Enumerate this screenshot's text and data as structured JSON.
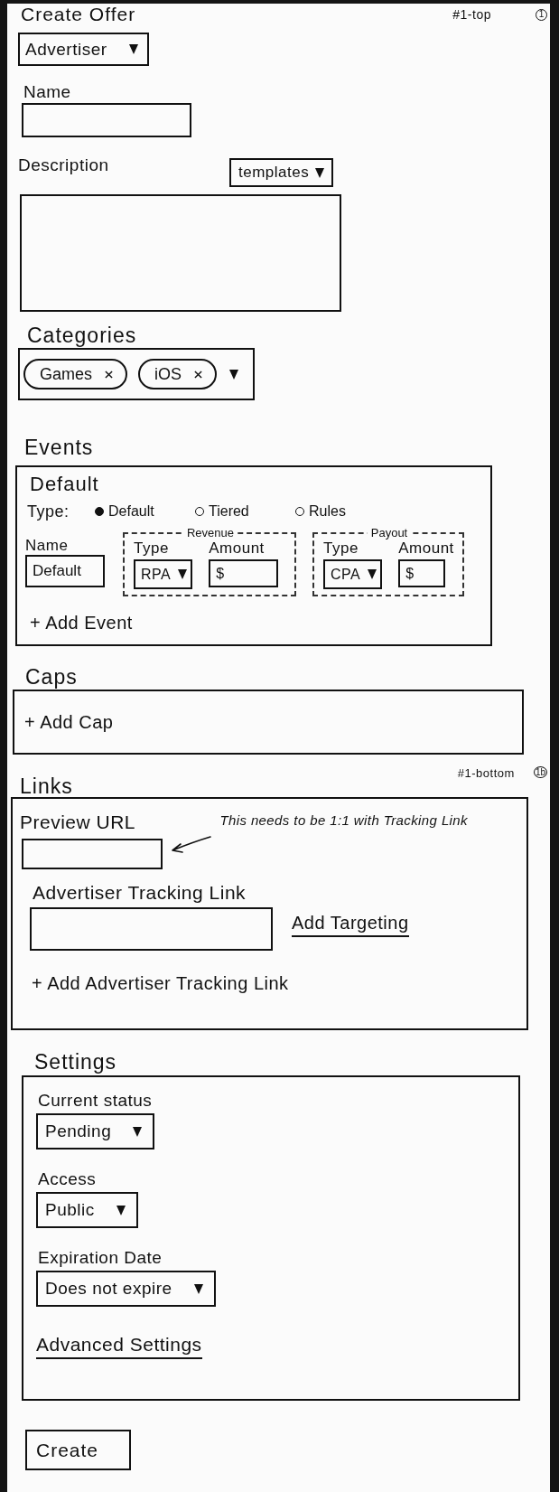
{
  "header": {
    "title": "Create Offer",
    "sheet_label": "#1-top",
    "sheet_number": "1",
    "advertiser_select": "Advertiser"
  },
  "name": {
    "label": "Name"
  },
  "description": {
    "label": "Description",
    "templates_select": "templates"
  },
  "categories": {
    "heading": "Categories",
    "tags": [
      "Games",
      "iOS"
    ]
  },
  "events": {
    "heading": "Events",
    "items": [
      {
        "title": "Default",
        "type_label": "Type:",
        "type_options": [
          {
            "label": "Default",
            "selected": true
          },
          {
            "label": "Tiered",
            "selected": false
          },
          {
            "label": "Rules",
            "selected": false
          }
        ],
        "name_label": "Name",
        "name_value": "Default",
        "groups": [
          {
            "title": "Revenue",
            "type_label": "Type",
            "type_value": "RPA",
            "amount_label": "Amount",
            "amount_value": "$"
          },
          {
            "title": "Payout",
            "type_label": "Type",
            "type_value": "CPA",
            "amount_label": "Amount",
            "amount_value": "$"
          }
        ]
      }
    ],
    "add_link": "+ Add Event"
  },
  "caps": {
    "heading": "Caps",
    "add_link": "+ Add Cap"
  },
  "links": {
    "heading": "Links",
    "sheet_label": "#1-bottom",
    "sheet_number": "1b",
    "preview_label": "Preview URL",
    "note": "This needs to be 1:1 with Tracking Link",
    "tracking_label": "Advertiser Tracking Link",
    "targeting_link": "Add Targeting",
    "add_link": "+ Add Advertiser Tracking Link"
  },
  "settings": {
    "heading": "Settings",
    "fields": [
      {
        "label": "Current status",
        "value": "Pending"
      },
      {
        "label": "Access",
        "value": "Public"
      },
      {
        "label": "Expiration Date",
        "value": "Does not expire"
      }
    ],
    "advanced_link": "Advanced Settings"
  },
  "create_button": "Create"
}
